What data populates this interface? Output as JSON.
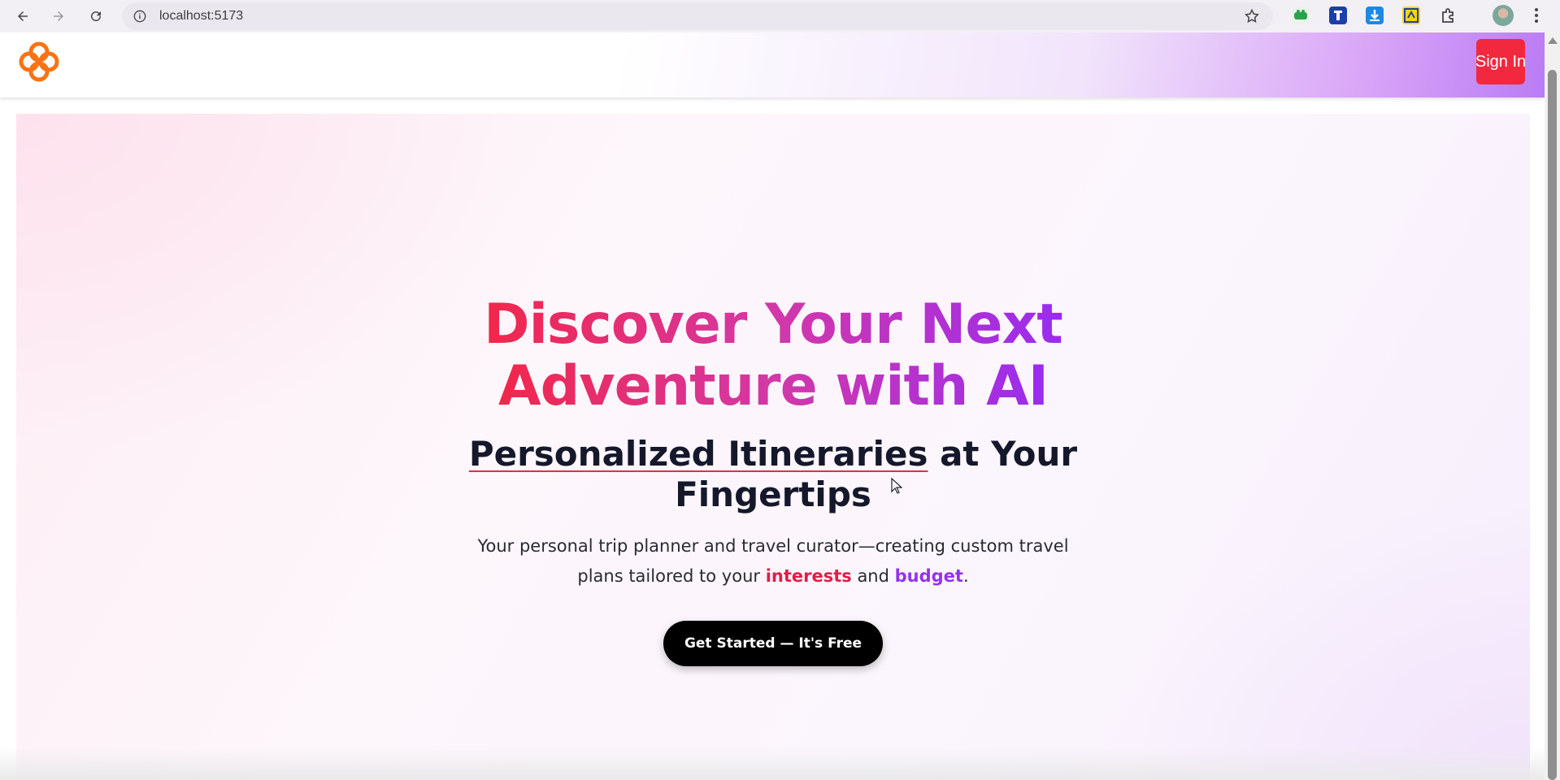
{
  "browser": {
    "url": "localhost:5173",
    "icons": [
      "back-icon",
      "forward-icon",
      "reload-icon",
      "info-icon",
      "star-icon",
      "extension-icon",
      "profile-avatar",
      "menu-icon"
    ]
  },
  "header": {
    "logo_icon": "flower-logo-icon",
    "signin_label": "Sign In",
    "signin_color": "#f2283f"
  },
  "hero": {
    "title_line1": "Discover Your Next",
    "title_line2": "Adventure with AI",
    "subtitle_underlined": "Personalized Itineraries",
    "subtitle_rest1": " at Your",
    "subtitle_line2": "Fingertips",
    "desc_line1": "Your personal trip planner and travel curator—creating custom travel",
    "desc_prefix2": "plans tailored to your ",
    "desc_highlight1": "interests",
    "desc_mid": " and ",
    "desc_highlight2": "budget",
    "desc_suffix": ".",
    "cta_label": "Get Started — It's Free",
    "gradient_start": "#f2274a",
    "gradient_end": "#9a2cf0"
  }
}
